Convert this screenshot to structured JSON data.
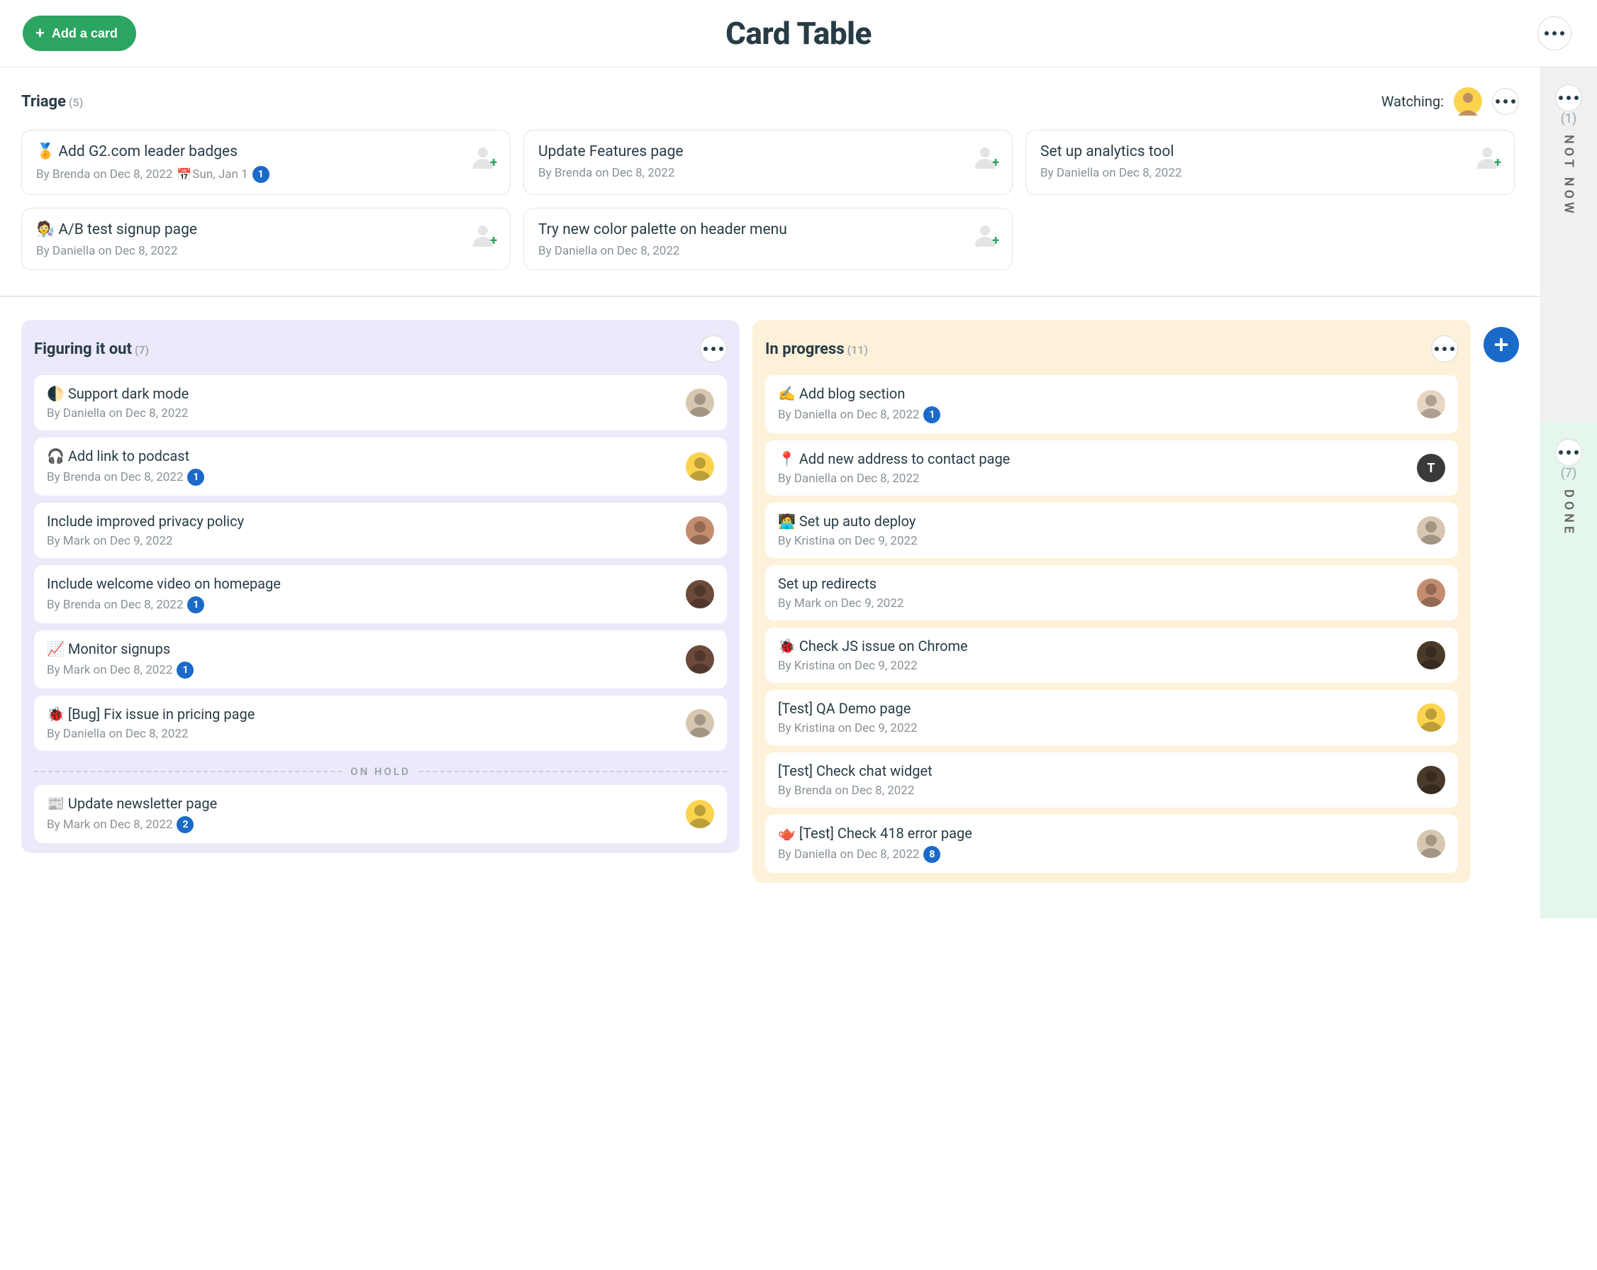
{
  "header": {
    "add_card_label": "Add a card",
    "title": "Card Table"
  },
  "triage": {
    "title": "Triage",
    "count": "(5)",
    "watching_label": "Watching:",
    "watcher_avatar_bg": "#fbd34d",
    "cards": [
      {
        "emoji": "🏅",
        "title": "Add G2.com leader badges",
        "meta": "By Brenda on Dec 8, 2022",
        "due": "Sun, Jan 1",
        "badge": "1",
        "has_placeholder": true
      },
      {
        "emoji": "",
        "title": "Update Features page",
        "meta": "By Brenda on Dec 8, 2022",
        "has_placeholder": true
      },
      {
        "emoji": "",
        "title": "Set up analytics tool",
        "meta": "By Daniella on Dec 8, 2022",
        "has_placeholder": true
      },
      {
        "emoji": "🧑‍🔬",
        "title": "A/B test signup page",
        "meta": "By Daniella on Dec 8, 2022",
        "has_placeholder": true
      },
      {
        "emoji": "",
        "title": "Try new color palette on header menu",
        "meta": "By Daniella on Dec 8, 2022",
        "has_placeholder": true
      }
    ]
  },
  "columns": [
    {
      "key": "figuring",
      "title": "Figuring it out",
      "count": "(7)",
      "cards": [
        {
          "emoji": "🌓",
          "title": "Support dark mode",
          "meta": "By Daniella on Dec 8, 2022",
          "avatar_bg": "#d8c7b0"
        },
        {
          "emoji": "🎧",
          "title": "Add link to podcast",
          "meta": "By Brenda on Dec 8, 2022",
          "badge": "1",
          "avatar_bg": "#fbd34d"
        },
        {
          "emoji": "",
          "title": "Include improved privacy policy",
          "meta": "By Mark on Dec 9, 2022",
          "avatar_bg": "#c48d6f"
        },
        {
          "emoji": "",
          "title": "Include welcome video on homepage",
          "meta": "By Brenda on Dec 8, 2022",
          "badge": "1",
          "avatar_bg": "#6b4a3a"
        },
        {
          "emoji": "📈",
          "title": "Monitor signups",
          "meta": "By Mark on Dec 8, 2022",
          "badge": "1",
          "avatar_bg": "#6b4a3a"
        },
        {
          "emoji": "🐞",
          "title": "[Bug] Fix issue in pricing page",
          "meta": "By Daniella on Dec 8, 2022",
          "avatar_bg": "#d8c7b0"
        }
      ],
      "on_hold_label": "ON HOLD",
      "on_hold_cards": [
        {
          "emoji": "📰",
          "title": "Update newsletter page",
          "meta": "By Mark on Dec 8, 2022",
          "badge": "2",
          "avatar_bg": "#fbd34d"
        }
      ]
    },
    {
      "key": "inprogress",
      "title": "In progress",
      "count": "(11)",
      "cards": [
        {
          "emoji": "✍️",
          "title": "Add blog section",
          "meta": "By Daniella on Dec 8, 2022",
          "badge": "1",
          "avatar_bg": "#e8d5c4"
        },
        {
          "emoji": "📍",
          "title": "Add new address to contact page",
          "meta": "By Daniella on Dec 8, 2022",
          "avatar_bg": "#3a3a3a",
          "avatar_text": "T"
        },
        {
          "emoji": "🧑‍💻",
          "title": "Set up auto deploy",
          "meta": "By Kristina on Dec 9, 2022",
          "avatar_bg": "#d8c7b0"
        },
        {
          "emoji": "",
          "title": "Set up redirects",
          "meta": "By Mark on Dec 9, 2022",
          "avatar_bg": "#c48d6f"
        },
        {
          "emoji": "🐞",
          "title": "Check JS issue on Chrome",
          "meta": "By Kristina on Dec 9, 2022",
          "avatar_bg": "#4a3a2a"
        },
        {
          "emoji": "",
          "title": "[Test] QA Demo page",
          "meta": "By Kristina on Dec 9, 2022",
          "avatar_bg": "#fbd34d"
        },
        {
          "emoji": "",
          "title": "[Test] Check chat widget",
          "meta": "By Brenda on Dec 8, 2022",
          "avatar_bg": "#4a3a2a"
        },
        {
          "emoji": "🫖",
          "title": "[Test] Check 418 error page",
          "meta": "By Daniella on Dec 8, 2022",
          "badge": "8",
          "avatar_bg": "#d8c7b0"
        }
      ]
    }
  ],
  "rails": {
    "not_now": {
      "count": "(1)",
      "label": "NOT NOW"
    },
    "done": {
      "count": "(7)",
      "label": "DONE"
    }
  }
}
